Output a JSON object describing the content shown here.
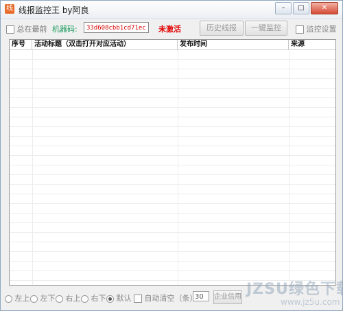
{
  "window": {
    "title": "线报监控王 by阿良",
    "app_icon_char": "线"
  },
  "toolbar": {
    "stay_on_top_label": "总在最前",
    "machine_code_label": "机器码:",
    "machine_code_value": "33d608cbb1cd71ec",
    "status_text": "未激活",
    "history_button": "历史线报",
    "monitor_button": "一键监控",
    "settings_label": "监控设置"
  },
  "table": {
    "columns": [
      "序号",
      "活动标题（双击打开对应活动）",
      "发布时间",
      "来源"
    ],
    "rows": []
  },
  "statusbar": {
    "positions": [
      {
        "label": "左上",
        "selected": false
      },
      {
        "label": "左下",
        "selected": false
      },
      {
        "label": "右上",
        "selected": false
      },
      {
        "label": "右下",
        "selected": false
      },
      {
        "label": "默认",
        "selected": true
      }
    ],
    "auto_clear_label": "自动清空（条）",
    "auto_clear_value": "30",
    "enterprise_button": "企业信用"
  },
  "watermark": {
    "main": "JZSU绿色下载",
    "sub": "www.jz5u.com"
  },
  "colors": {
    "machine_label": "#1b9a5c",
    "machine_value": "#d40000",
    "status_text": "#e00000"
  }
}
